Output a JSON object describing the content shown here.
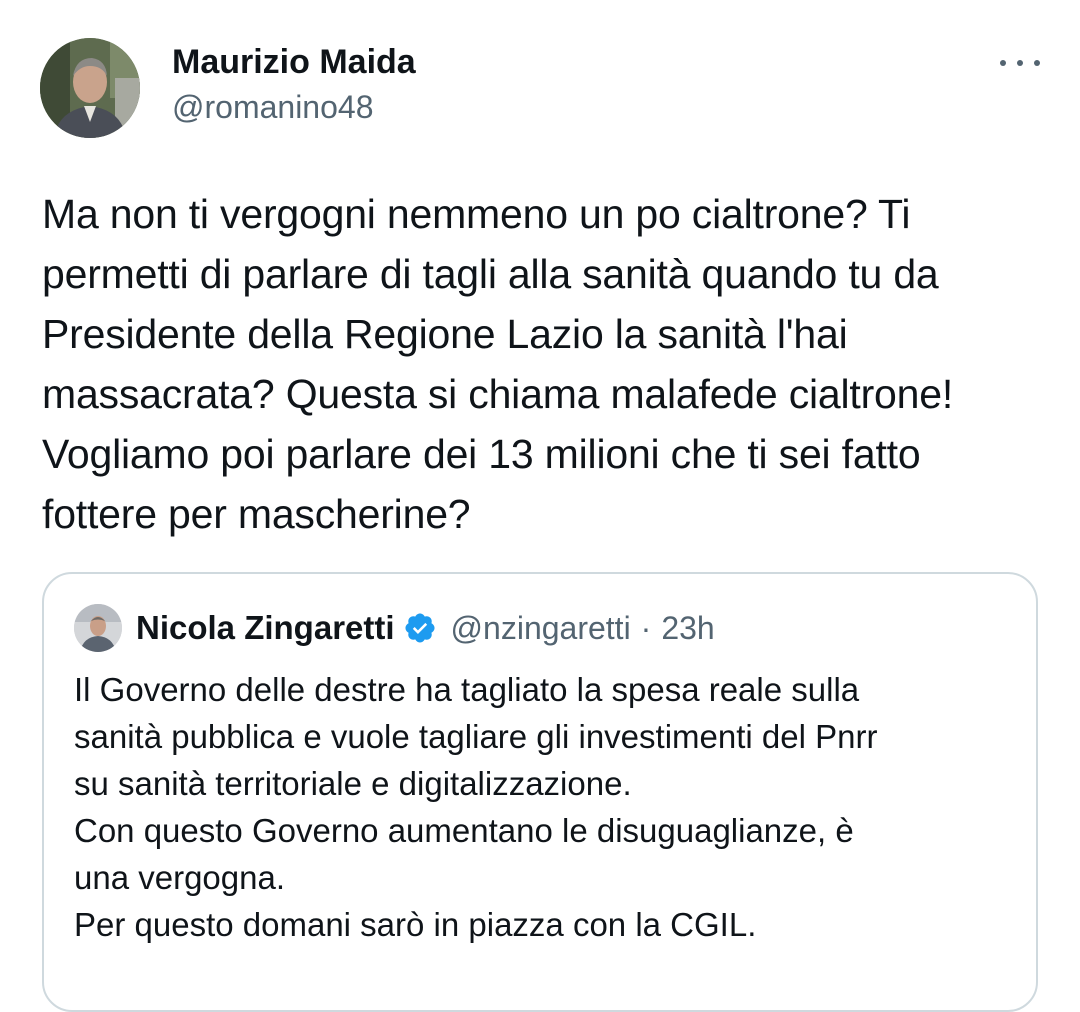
{
  "author": {
    "display_name": "Maurizio Maida",
    "handle": "@romanino48",
    "avatar_icon": "profile-photo-avatar"
  },
  "more_icon": "more-horizontal-icon",
  "tweet": {
    "text": "Ma non ti vergogni nemmeno un po cialtrone? Ti\npermetti di parlare di tagli alla sanità quando tu da\nPresidente della Regione Lazio la sanità l'hai\nmassacrata? Questa si chiama malafede cialtrone!\nVogliamo poi parlare dei 13 milioni che ti sei fatto\nfottere per mascherine?"
  },
  "quoted": {
    "display_name": "Nicola Zingaretti",
    "verified_icon": "verified-badge-icon",
    "handle": "@nzingaretti",
    "separator": "·",
    "time": "23h",
    "text": "Il Governo delle destre ha tagliato la spesa reale sulla\nsanità pubblica e vuole tagliare gli investimenti del Pnrr\nsu sanità territoriale e digitalizzazione.\nCon questo Governo aumentano le disuguaglianze, è\nuna vergogna.\nPer questo domani sarò in piazza con la CGIL."
  },
  "colors": {
    "text_primary": "#0f1419",
    "text_secondary": "#536471",
    "border": "#cfd9de",
    "verified_blue": "#1d9bf0"
  }
}
